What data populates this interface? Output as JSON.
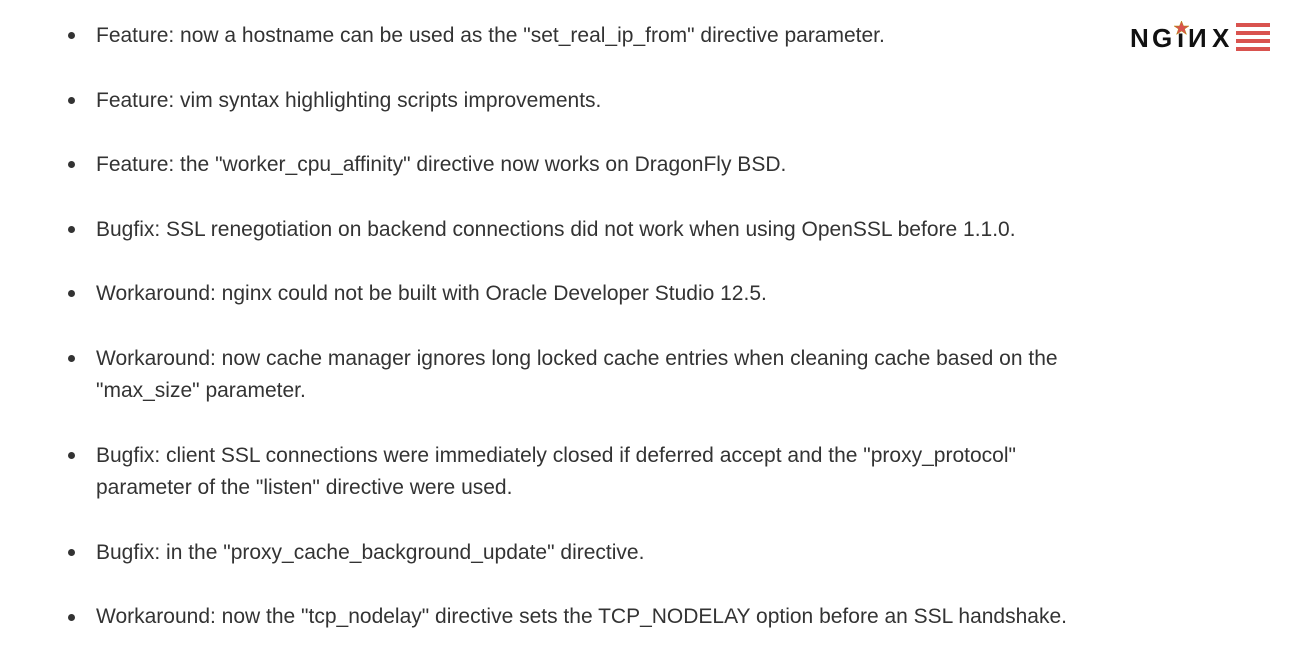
{
  "logo": {
    "text": "NGINX"
  },
  "changelog": {
    "items": [
      "Feature: now a hostname can be used as the \"set_real_ip_from\" directive parameter.",
      "Feature: vim syntax highlighting scripts improvements.",
      "Feature: the \"worker_cpu_affinity\" directive now works on DragonFly BSD.",
      "Bugfix: SSL renegotiation on backend connections did not work when using OpenSSL before 1.1.0.",
      "Workaround: nginx could not be built with Oracle Developer Studio 12.5.",
      "Workaround: now cache manager ignores long locked cache entries when cleaning cache based on the \"max_size\" parameter.",
      "Bugfix: client SSL connections were immediately closed if deferred accept and the \"proxy_protocol\" parameter of the \"listen\" directive were used.",
      "Bugfix: in the \"proxy_cache_background_update\" directive.",
      "Workaround: now the \"tcp_nodelay\" directive sets the TCP_NODELAY option before an SSL handshake."
    ]
  }
}
